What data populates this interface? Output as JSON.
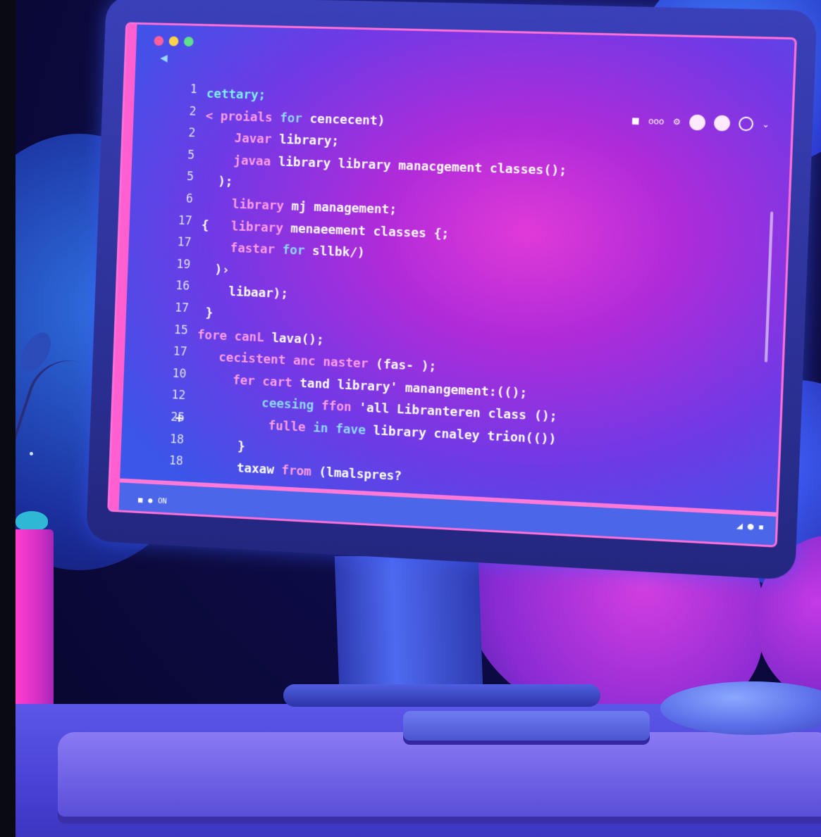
{
  "window": {
    "traffic_lights": [
      "#ff5f9a",
      "#ffd24a",
      "#5fe08a"
    ],
    "back_icon": "back-arrow-icon"
  },
  "toolbar": {
    "text_label": "ooo",
    "icons": [
      "folder-icon",
      "settings-icon",
      "circle-icon",
      "circle-icon",
      "ring-icon",
      "chevron-down-icon"
    ]
  },
  "editor": {
    "line_numbers": [
      "1",
      "2",
      "2",
      "5",
      "5",
      "6",
      "17",
      "17",
      "19",
      "16",
      "17",
      "15",
      "17",
      "10",
      "12",
      "25",
      "18",
      "18"
    ],
    "lines": [
      {
        "segs": [
          {
            "t": "cettary;",
            "c": "#7ef0ff"
          }
        ]
      },
      {
        "segs": [
          {
            "t": "< ",
            "c": "#ff9de8"
          },
          {
            "t": "proials",
            "c": "#ff9de8"
          },
          {
            "t": " for ",
            "c": "#8fd8ff"
          },
          {
            "t": "cencecent)",
            "c": "#ffffff"
          }
        ]
      },
      {
        "segs": [
          {
            "t": "    Javar",
            "c": "#ff9de8"
          },
          {
            "t": " library;",
            "c": "#ffffff"
          }
        ]
      },
      {
        "segs": [
          {
            "t": "    javaa",
            "c": "#ff9de8"
          },
          {
            "t": " library library manacgement classes();",
            "c": "#ffffff"
          }
        ]
      },
      {
        "segs": [
          {
            "t": "  );",
            "c": "#ffffff"
          }
        ]
      },
      {
        "segs": [
          {
            "t": "    library",
            "c": "#ff9de8"
          },
          {
            "t": " mj management;",
            "c": "#ffffff"
          }
        ]
      },
      {
        "segs": [
          {
            "t": "{   ",
            "c": "#ffffff"
          },
          {
            "t": "library",
            "c": "#ff9de8"
          },
          {
            "t": " menaeement classes {;",
            "c": "#ffffff"
          }
        ]
      },
      {
        "segs": [
          {
            "t": "    fastar",
            "c": "#ff9de8"
          },
          {
            "t": " for ",
            "c": "#8fd8ff"
          },
          {
            "t": "sllbk/)",
            "c": "#ffffff"
          }
        ]
      },
      {
        "segs": [
          {
            "t": "  )›",
            "c": "#ffffff"
          }
        ]
      },
      {
        "segs": [
          {
            "t": "    libaar);",
            "c": "#ffffff"
          }
        ]
      },
      {
        "segs": [
          {
            "t": " }",
            "c": "#ffffff"
          }
        ]
      },
      {
        "segs": [
          {
            "t": "fore",
            "c": "#ff9de8"
          },
          {
            "t": " canL ",
            "c": "#ff9de8"
          },
          {
            "t": "lava();",
            "c": "#ffffff"
          }
        ]
      },
      {
        "segs": [
          {
            "t": "   ",
            "c": "#ffffff"
          },
          {
            "t": "cecistent",
            "c": "#ff9de8"
          },
          {
            "t": " anc ",
            "c": "#ff9de8"
          },
          {
            "t": "naster",
            "c": "#ff9de8"
          },
          {
            "t": " (fas- );",
            "c": "#ffffff"
          }
        ]
      },
      {
        "segs": [
          {
            "t": "     ",
            "c": "#ffffff"
          },
          {
            "t": "fer cart",
            "c": "#ff9de8"
          },
          {
            "t": " tand library' manangement:(();",
            "c": "#ffffff"
          }
        ]
      },
      {
        "segs": [
          {
            "t": "         ",
            "c": "#ffffff"
          },
          {
            "t": "ceesing",
            "c": "#8fd8ff"
          },
          {
            "t": " ffon ",
            "c": "#ff9de8"
          },
          {
            "t": "'all Libranteren class ();",
            "c": "#ffffff"
          }
        ]
      },
      {
        "segs": [
          {
            "t": "          ",
            "c": "#ffffff"
          },
          {
            "t": "fulle",
            "c": "#ff9de8"
          },
          {
            "t": " in fave ",
            "c": "#8fd8ff"
          },
          {
            "t": "library cnaley trion(())",
            "c": "#ffffff"
          }
        ]
      },
      {
        "segs": [
          {
            "t": "      }",
            "c": "#ffffff"
          }
        ]
      },
      {
        "segs": [
          {
            "t": "      ",
            "c": "#ffffff"
          },
          {
            "t": "taxaw",
            "c": "#ffffff"
          },
          {
            "t": " from ",
            "c": "#ff9de8"
          },
          {
            "t": "(lmalspres?",
            "c": "#ffffff"
          }
        ]
      }
    ],
    "side_brackets": [
      "+"
    ]
  },
  "statusbar": {
    "left_text": "ON",
    "right_icons": [
      "signal-icon",
      "pin-icon",
      "wifi-icon"
    ]
  }
}
